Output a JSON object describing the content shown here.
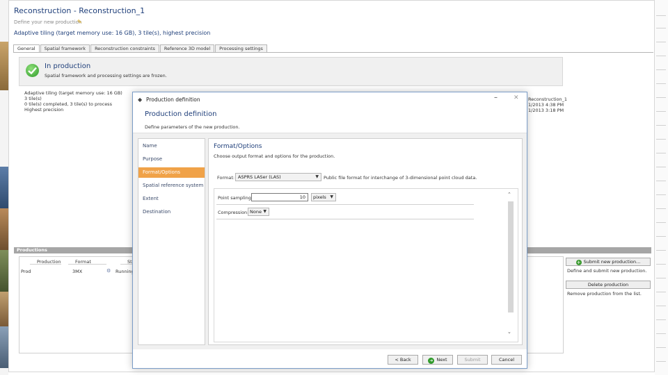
{
  "window": {
    "title": "Reconstruction - Reconstruction_1",
    "subtitle": "Define your new production",
    "info": "Adaptive tiling (target memory use: 16 GB), 3 tile(s), highest precision"
  },
  "tabs": [
    {
      "label": "General"
    },
    {
      "label": "Spatial framework"
    },
    {
      "label": "Reconstruction constraints"
    },
    {
      "label": "Reference 3D model"
    },
    {
      "label": "Processing settings"
    }
  ],
  "status_banner": {
    "title": "In production",
    "description": "Spatial framework and processing settings are frozen."
  },
  "background_details": {
    "lines": [
      "Adaptive tiling (target memory use: 16 GB)",
      "3 tile(s)",
      "0 tile(s) completed, 3 tile(s) to process",
      "Highest precision"
    ],
    "right_lines": [
      "Reconstruction_1",
      "1/2013 4:38 PM",
      "1/2013 3:18 PM"
    ]
  },
  "productions_panel": {
    "header": "Productions",
    "columns": [
      "Production",
      "Format",
      "Status"
    ],
    "rows": [
      {
        "production": "Prod",
        "format": "3MX",
        "status": "Running"
      }
    ]
  },
  "side_actions": {
    "submit_label": "Submit new production...",
    "submit_desc": "Define and submit new production.",
    "delete_label": "Delete production",
    "delete_desc": "Remove production from the list."
  },
  "dialog": {
    "title": "Production definition",
    "header": "Production definition",
    "description": "Define parameters of the new production.",
    "steps": [
      {
        "label": "Name"
      },
      {
        "label": "Purpose"
      },
      {
        "label": "Format/Options"
      },
      {
        "label": "Spatial reference system"
      },
      {
        "label": "Extent"
      },
      {
        "label": "Destination"
      }
    ],
    "active_step": "Format/Options",
    "panel": {
      "title": "Format/Options",
      "description": "Choose output format and options for the production.",
      "format_label": "Format:",
      "format_value": "ASPRS LASer (LAS)",
      "format_desc": "Public file format for interchange of 3-dimensional point cloud data.",
      "point_sampling_label": "Point sampling:",
      "point_sampling_value": "10",
      "point_sampling_unit": "pixels",
      "compression_label": "Compression:",
      "compression_value": "None"
    },
    "buttons": {
      "back": "< Back",
      "next": "Next",
      "submit": "Submit",
      "cancel": "Cancel"
    }
  },
  "colors": {
    "accent": "#f0a248",
    "title_blue": "#1f3f7a",
    "success_green": "#2f9a2a"
  }
}
